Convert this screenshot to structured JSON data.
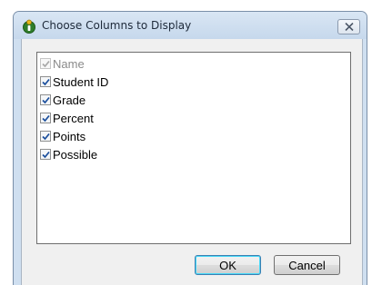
{
  "window": {
    "title": "Choose Columns to Display"
  },
  "columns": [
    {
      "label": "Name",
      "checked": true,
      "enabled": false
    },
    {
      "label": "Student ID",
      "checked": true,
      "enabled": true
    },
    {
      "label": "Grade",
      "checked": true,
      "enabled": true
    },
    {
      "label": "Percent",
      "checked": true,
      "enabled": true
    },
    {
      "label": "Points",
      "checked": true,
      "enabled": true
    },
    {
      "label": "Possible",
      "checked": true,
      "enabled": true
    }
  ],
  "buttons": {
    "ok_label": "OK",
    "cancel_label": "Cancel"
  },
  "colors": {
    "titlebar": "#cfdff0",
    "check": "#1a4e9c",
    "ok_focus": "#3c7fb1"
  },
  "icons": {
    "app": "info-person-icon",
    "close": "close-icon",
    "check": "checkmark-icon"
  }
}
